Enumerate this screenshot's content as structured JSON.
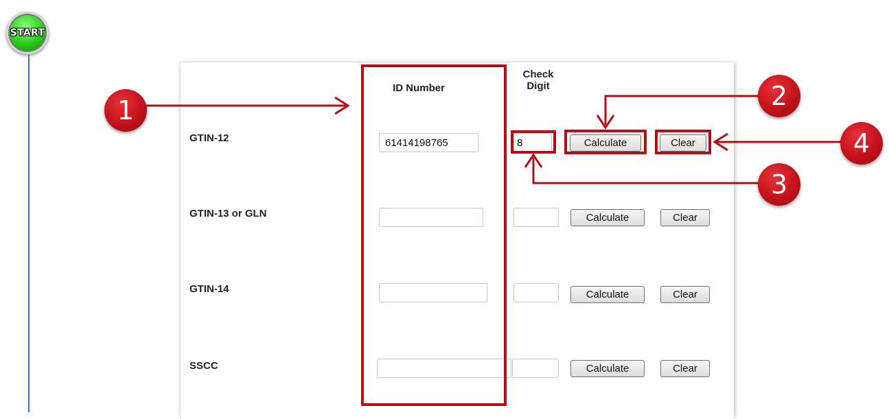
{
  "flow": {
    "start_label": "START"
  },
  "headers": {
    "id_number": "ID Number",
    "check_digit": "Check Digit"
  },
  "rows": [
    {
      "label": "GTIN-12",
      "id_value": "61414198765",
      "check_value": "8",
      "calculate": "Calculate",
      "clear": "Clear"
    },
    {
      "label": "GTIN-13 or GLN",
      "id_value": "",
      "check_value": "",
      "calculate": "Calculate",
      "clear": "Clear"
    },
    {
      "label": "GTIN-14",
      "id_value": "",
      "check_value": "",
      "calculate": "Calculate",
      "clear": "Clear"
    },
    {
      "label": "SSCC",
      "id_value": "",
      "check_value": "",
      "calculate": "Calculate",
      "clear": "Clear"
    }
  ],
  "callouts": [
    "1",
    "2",
    "3",
    "4"
  ],
  "colors": {
    "annotation": "#b00e14",
    "start_badge": "#2fd11f",
    "flow_line": "#3d6fd6"
  }
}
